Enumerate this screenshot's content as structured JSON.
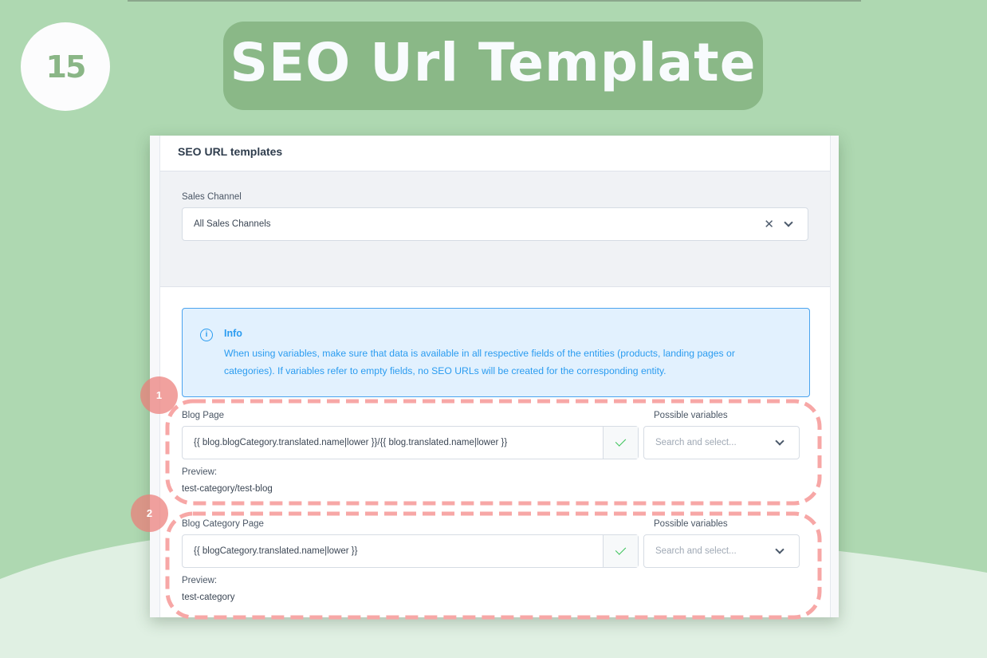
{
  "banner": {
    "step_number": "15",
    "title": "SEO Url Template"
  },
  "colors": {
    "background_green": "#aed8b1",
    "background_light": "#e0f0e3",
    "pill_green": "#8ab887",
    "info_blue": "#2b9cf0",
    "annotation_red": "#f7a7a6",
    "check_green": "#3cc35a"
  },
  "card": {
    "title": "SEO URL templates"
  },
  "sales_channel": {
    "label": "Sales Channel",
    "value": "All Sales Channels",
    "clear_icon": "close-icon",
    "dropdown_icon": "chevron-down-icon"
  },
  "info": {
    "icon": "info-icon",
    "icon_glyph": "i",
    "title": "Info",
    "text": "When using variables, make sure that data is available in all respective fields of the entities (products, landing pages or categories). If variables refer to empty fields, no SEO URLs will be created for the corresponding entity."
  },
  "templates": [
    {
      "annotation_number": "1",
      "label": "Blog Page",
      "value": "{{ blog.blogCategory.translated.name|lower }}/{{ blog.translated.name|lower }}",
      "valid_icon": "check-icon",
      "variables_label": "Possible variables",
      "variables_placeholder": "Search and select...",
      "preview_label": "Preview:",
      "preview_value": "test-category/test-blog"
    },
    {
      "annotation_number": "2",
      "label": "Blog Category Page",
      "value": "{{ blogCategory.translated.name|lower }}",
      "valid_icon": "check-icon",
      "variables_label": "Possible variables",
      "variables_placeholder": "Search and select...",
      "preview_label": "Preview:",
      "preview_value": "test-category"
    }
  ]
}
